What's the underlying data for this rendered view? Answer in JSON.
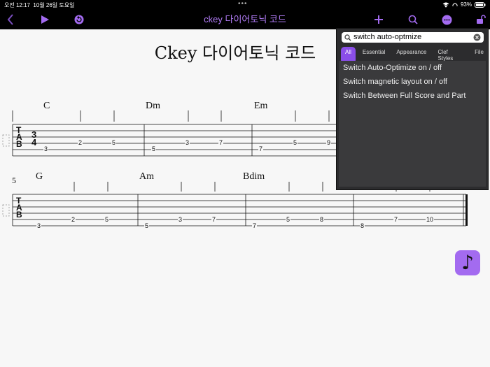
{
  "status": {
    "time": "오전 12:17",
    "date": "10월 26일 토요일",
    "battery": "93%"
  },
  "toolbar": {
    "title": "ckey 다이어토닉 코드"
  },
  "document": {
    "title": "Ckey 다이어토닉 코드",
    "tab_label": [
      "T",
      "A",
      "B"
    ],
    "time_signature": [
      "3",
      "4"
    ],
    "system2_measure_number": "5",
    "system1_chords": [
      "C",
      "Dm",
      "Em"
    ],
    "system2_chords": [
      "G",
      "Am",
      "Bdim"
    ],
    "system1_frets": [
      "3",
      "2",
      "5",
      "5",
      "3",
      "7",
      "7",
      "5",
      "9"
    ],
    "system2_frets": [
      "3",
      "2",
      "5",
      "5",
      "3",
      "7",
      "7",
      "5",
      "8",
      "8",
      "7",
      "10"
    ]
  },
  "search": {
    "query": "switch auto-optmize",
    "tabs": [
      "All",
      "Essential",
      "Appearance",
      "Clef Styles",
      "File"
    ],
    "results": [
      "Switch Auto-Optimize on / off",
      "Switch magnetic layout on / off",
      "Switch Between Full Score and Part"
    ]
  },
  "fab": {
    "glyph": "♪"
  },
  "colors": {
    "accent": "#a36bf0",
    "bar": "#000000",
    "popup": "#2c2c2e"
  }
}
